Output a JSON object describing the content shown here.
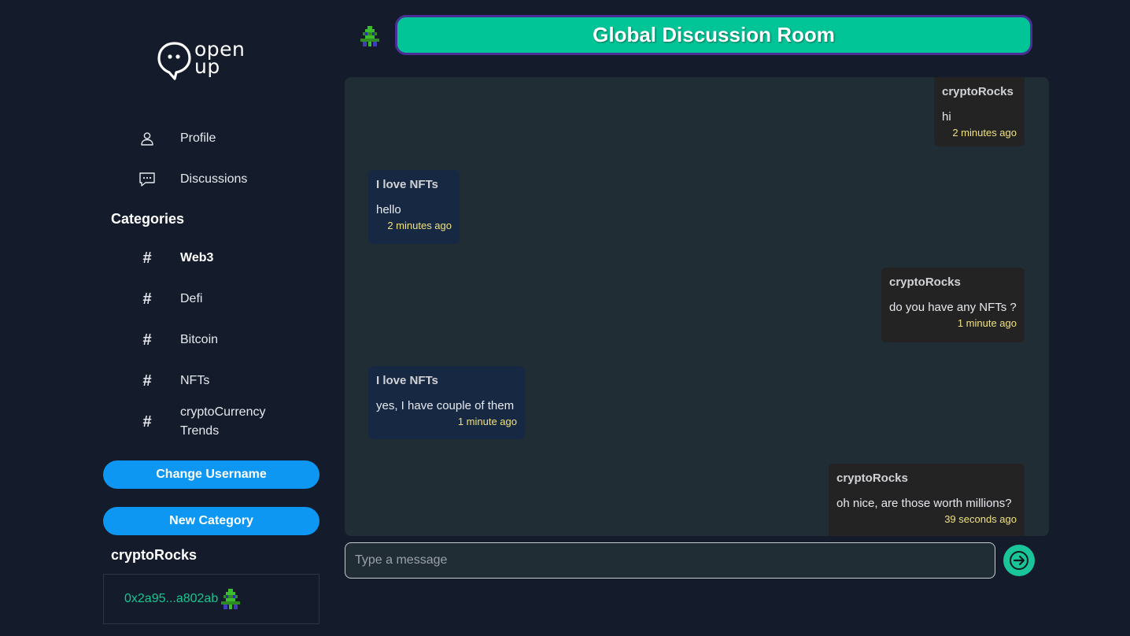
{
  "app": {
    "logo_line1": "open",
    "logo_line2": "up"
  },
  "sidebar": {
    "nav": [
      {
        "label": "Profile",
        "icon": "user-icon"
      },
      {
        "label": "Discussions",
        "icon": "chat-bubble-icon"
      }
    ],
    "categories_heading": "Categories",
    "categories": [
      {
        "label": "Web3",
        "active": true
      },
      {
        "label": "Defi"
      },
      {
        "label": "Bitcoin"
      },
      {
        "label": "NFTs"
      },
      {
        "label": "cryptoCurrency Trends"
      }
    ],
    "change_username_label": "Change Username",
    "new_category_label": "New Category",
    "username": "cryptoRocks",
    "wallet_address": "0x2a95...a802ab"
  },
  "room": {
    "title": "Global Discussion Room"
  },
  "messages": [
    {
      "author": "cryptoRocks",
      "text": "hi",
      "time": "2 minutes ago",
      "mine": true
    },
    {
      "author": "I love NFTs",
      "text": "hello",
      "time": "2 minutes ago",
      "mine": false
    },
    {
      "author": "cryptoRocks",
      "text": "do you have any NFTs ?",
      "time": "1 minute ago",
      "mine": true
    },
    {
      "author": "I love NFTs",
      "text": "yes, I have couple of them",
      "time": "1 minute ago",
      "mine": false
    },
    {
      "author": "cryptoRocks",
      "text": "oh nice, are those worth millions?",
      "time": "39 seconds ago",
      "mine": true
    }
  ],
  "composer": {
    "placeholder": "Type a message",
    "value": ""
  },
  "colors": {
    "background": "#141c2b",
    "accent_green": "#02c597",
    "button_blue": "#0d96f2",
    "title_border": "#4b2f96",
    "timestamp": "#f0e17e",
    "wallet_text": "#17c590"
  }
}
